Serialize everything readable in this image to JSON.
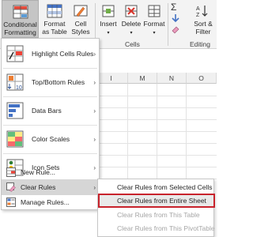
{
  "ribbon": {
    "conditional_formatting": "Conditional Formatting",
    "format_as_table": "Format as Table",
    "cell_styles": "Cell Styles",
    "insert": "Insert",
    "delete": "Delete",
    "format": "Format",
    "sort_filter": "Sort & Filter",
    "sigma_glyph": "Σ",
    "cells_group": "Cells",
    "editing_group": "Editing"
  },
  "columns": [
    "I",
    "M",
    "N",
    "O"
  ],
  "menu": {
    "items": [
      {
        "label": "Highlight Cells Rules",
        "mnemonic": "H"
      },
      {
        "label": "Top/Bottom Rules",
        "mnemonic": "T"
      },
      {
        "label": "Data Bars",
        "mnemonic": "D"
      },
      {
        "label": "Color Scales",
        "mnemonic": "S"
      },
      {
        "label": "Icon Sets",
        "mnemonic": "I"
      },
      {
        "label": "New Rule...",
        "mnemonic": "N"
      },
      {
        "label": "Clear Rules",
        "mnemonic": "C"
      },
      {
        "label": "Manage Rules...",
        "mnemonic": "R"
      }
    ]
  },
  "submenu": {
    "items": [
      {
        "label": "Clear Rules from Selected Cells",
        "enabled": true
      },
      {
        "label": "Clear Rules from Entire Sheet",
        "enabled": true,
        "selected": true
      },
      {
        "label": "Clear Rules from This Table",
        "enabled": false
      },
      {
        "label": "Clear Rules from This PivotTable",
        "enabled": false
      }
    ]
  },
  "colors": {
    "highlight_border": "#c8232c",
    "ribbon_bg": "#f3f3f3",
    "menu_hover": "#d6d6d6"
  }
}
